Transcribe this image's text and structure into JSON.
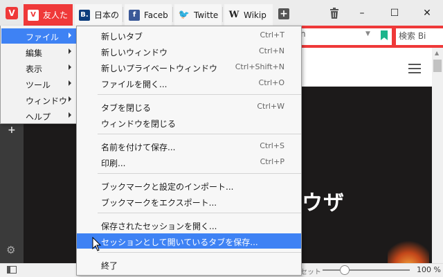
{
  "tabs": [
    {
      "title": "友人た",
      "favicon": "V",
      "active": true
    },
    {
      "title": "日本の",
      "favicon": "B."
    },
    {
      "title": "Faceb",
      "favicon": "f"
    },
    {
      "title": "Twitte",
      "favicon": "🐦"
    },
    {
      "title": "Wikip",
      "favicon": "W"
    }
  ],
  "window_controls": {
    "minimize": "–",
    "maximize": "☐",
    "close": "✕"
  },
  "addressbar": {
    "text": "n"
  },
  "search": {
    "text": "検索 Bi"
  },
  "main_menu": [
    {
      "label": "ファイル",
      "selected": true
    },
    {
      "label": "編集"
    },
    {
      "label": "表示"
    },
    {
      "label": "ツール"
    },
    {
      "label": "ウィンドウ"
    },
    {
      "label": "ヘルプ"
    }
  ],
  "file_menu": [
    {
      "label": "新しいタブ",
      "shortcut": "Ctrl+T"
    },
    {
      "label": "新しいウィンドウ",
      "shortcut": "Ctrl+N"
    },
    {
      "label": "新しいプライベートウィンドウ",
      "shortcut": "Ctrl+Shift+N"
    },
    {
      "label": "ファイルを開く...",
      "shortcut": "Ctrl+O"
    },
    {
      "label": "タブを閉じる",
      "shortcut": "Ctrl+W"
    },
    {
      "label": "ウィンドウを閉じる",
      "shortcut": ""
    },
    {
      "label": "名前を付けて保存...",
      "shortcut": "Ctrl+S"
    },
    {
      "label": "印刷...",
      "shortcut": "Ctrl+P"
    },
    {
      "label": "ブックマークと設定のインポート...",
      "shortcut": ""
    },
    {
      "label": "ブックマークをエクスポート...",
      "shortcut": ""
    },
    {
      "label": "保存されたセッションを開く...",
      "shortcut": ""
    },
    {
      "label": "セッションとして開いているタブを保存...",
      "shortcut": "",
      "selected": true
    },
    {
      "label": "終了",
      "shortcut": ""
    }
  ],
  "page": {
    "headline": "ウザ"
  },
  "statusbar": {
    "reset_label": "セット",
    "zoom": "100 %",
    "zoom_fraction": 0.25
  }
}
